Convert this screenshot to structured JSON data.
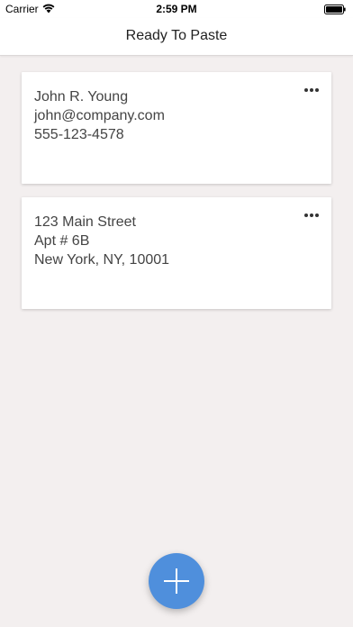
{
  "status_bar": {
    "carrier": "Carrier",
    "time": "2:59 PM"
  },
  "nav": {
    "title": "Ready To Paste"
  },
  "cards": [
    {
      "lines": [
        "John R. Young",
        "john@company.com",
        "555-123-4578"
      ]
    },
    {
      "lines": [
        "123 Main Street",
        "Apt # 6B",
        "New York, NY, 10001"
      ]
    }
  ],
  "colors": {
    "background": "#f3efef",
    "accent": "#4f8fdc"
  },
  "icons": {
    "more": "more-dots-icon",
    "add": "plus-icon"
  }
}
